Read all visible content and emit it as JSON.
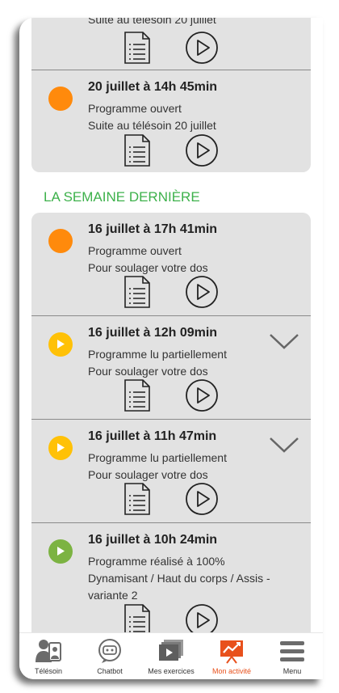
{
  "partial_top": {
    "subtitle": "Suite au télésoin 20 juillet"
  },
  "card1": [
    {
      "title": "20 juillet à 14h 45min",
      "line1": "Programme ouvert",
      "line2": "Suite au télésoin 20 juillet",
      "status": "orange"
    }
  ],
  "section": {
    "title": "LA SEMAINE DERNIÈRE"
  },
  "card2": [
    {
      "title": "16 juillet à 17h 41min",
      "line1": "Programme ouvert",
      "line2": "Pour soulager votre dos",
      "status": "orange"
    },
    {
      "title": "16 juillet à 12h 09min",
      "line1": "Programme lu partiellement",
      "line2": "Pour soulager votre dos",
      "status": "yellow"
    },
    {
      "title": "16 juillet à 11h 47min",
      "line1": "Programme lu partiellement",
      "line2": "Pour soulager votre dos",
      "status": "yellow"
    },
    {
      "title": "16 juillet à 10h 24min",
      "line1": "Programme réalisé à 100%",
      "line2": "Dynamisant / Haut du corps / Assis -",
      "line3": "variante 2",
      "status": "green"
    }
  ],
  "colors": {
    "orange": "#ff8a0c",
    "yellow": "#ffc107",
    "green": "#7cb342",
    "accent": "#3db14b",
    "active_tab": "#e8511c"
  },
  "tabbar": {
    "tabs": [
      {
        "label": "Télésoin",
        "icon": "telesoin-icon"
      },
      {
        "label": "Chatbot",
        "icon": "chatbot-icon"
      },
      {
        "label": "Mes exercices",
        "icon": "exercises-icon"
      },
      {
        "label": "Mon activité",
        "icon": "activity-icon",
        "active": true
      },
      {
        "label": "Menu",
        "icon": "menu-icon"
      }
    ]
  }
}
